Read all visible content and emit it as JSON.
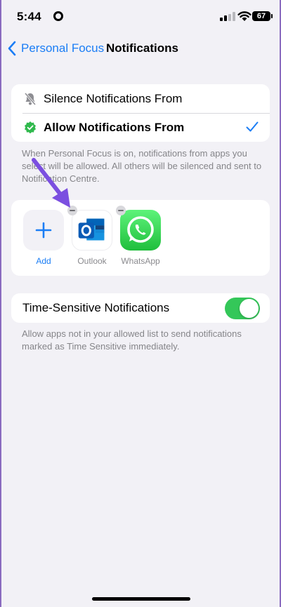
{
  "status_bar": {
    "time": "5:44",
    "battery_level": "67",
    "icons": [
      "location-icon",
      "cellular-signal-icon",
      "wifi-icon",
      "battery-icon"
    ]
  },
  "nav": {
    "back_label": "Personal Focus",
    "title": "Notifications",
    "back_icon": "chevron-left-icon"
  },
  "notification_mode": {
    "options": [
      {
        "label": "Silence Notifications From",
        "icon": "bell-slash-icon",
        "selected": false
      },
      {
        "label": "Allow Notifications From",
        "icon": "checkmark-seal-icon",
        "selected": true
      }
    ],
    "footnote": "When Personal Focus is on, notifications from apps you select will be allowed. All others will be silenced and sent to Notification Centre."
  },
  "allowed_apps": {
    "add_label": "Add",
    "apps": [
      {
        "name": "Outlook",
        "icon": "outlook-icon"
      },
      {
        "name": "WhatsApp",
        "icon": "whatsapp-icon"
      }
    ]
  },
  "time_sensitive": {
    "label": "Time-Sensitive Notifications",
    "enabled": true,
    "footnote": "Allow apps not in your allowed list to send notifications marked as Time Sensitive immediately."
  },
  "colors": {
    "accent": "#1a7df5",
    "toggle_on": "#34c759",
    "background": "#f2f1f6",
    "annotation_arrow": "#7b4fe0"
  }
}
